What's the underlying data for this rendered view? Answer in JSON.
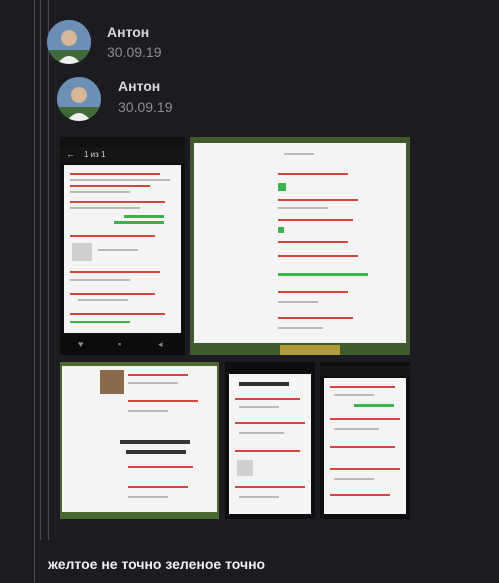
{
  "messages": [
    {
      "author": "Антон",
      "date": "30.09.19"
    },
    {
      "author": "Антон",
      "date": "30.09.19"
    }
  ],
  "phone_screen": {
    "header_title": "1 из 1"
  },
  "bottom_message": "желтое не точно зеленое точно",
  "colors": {
    "background": "#1c1b20",
    "thread_line": "#4a4a50",
    "author": "#d8d8d8",
    "date": "#8d8d92"
  }
}
